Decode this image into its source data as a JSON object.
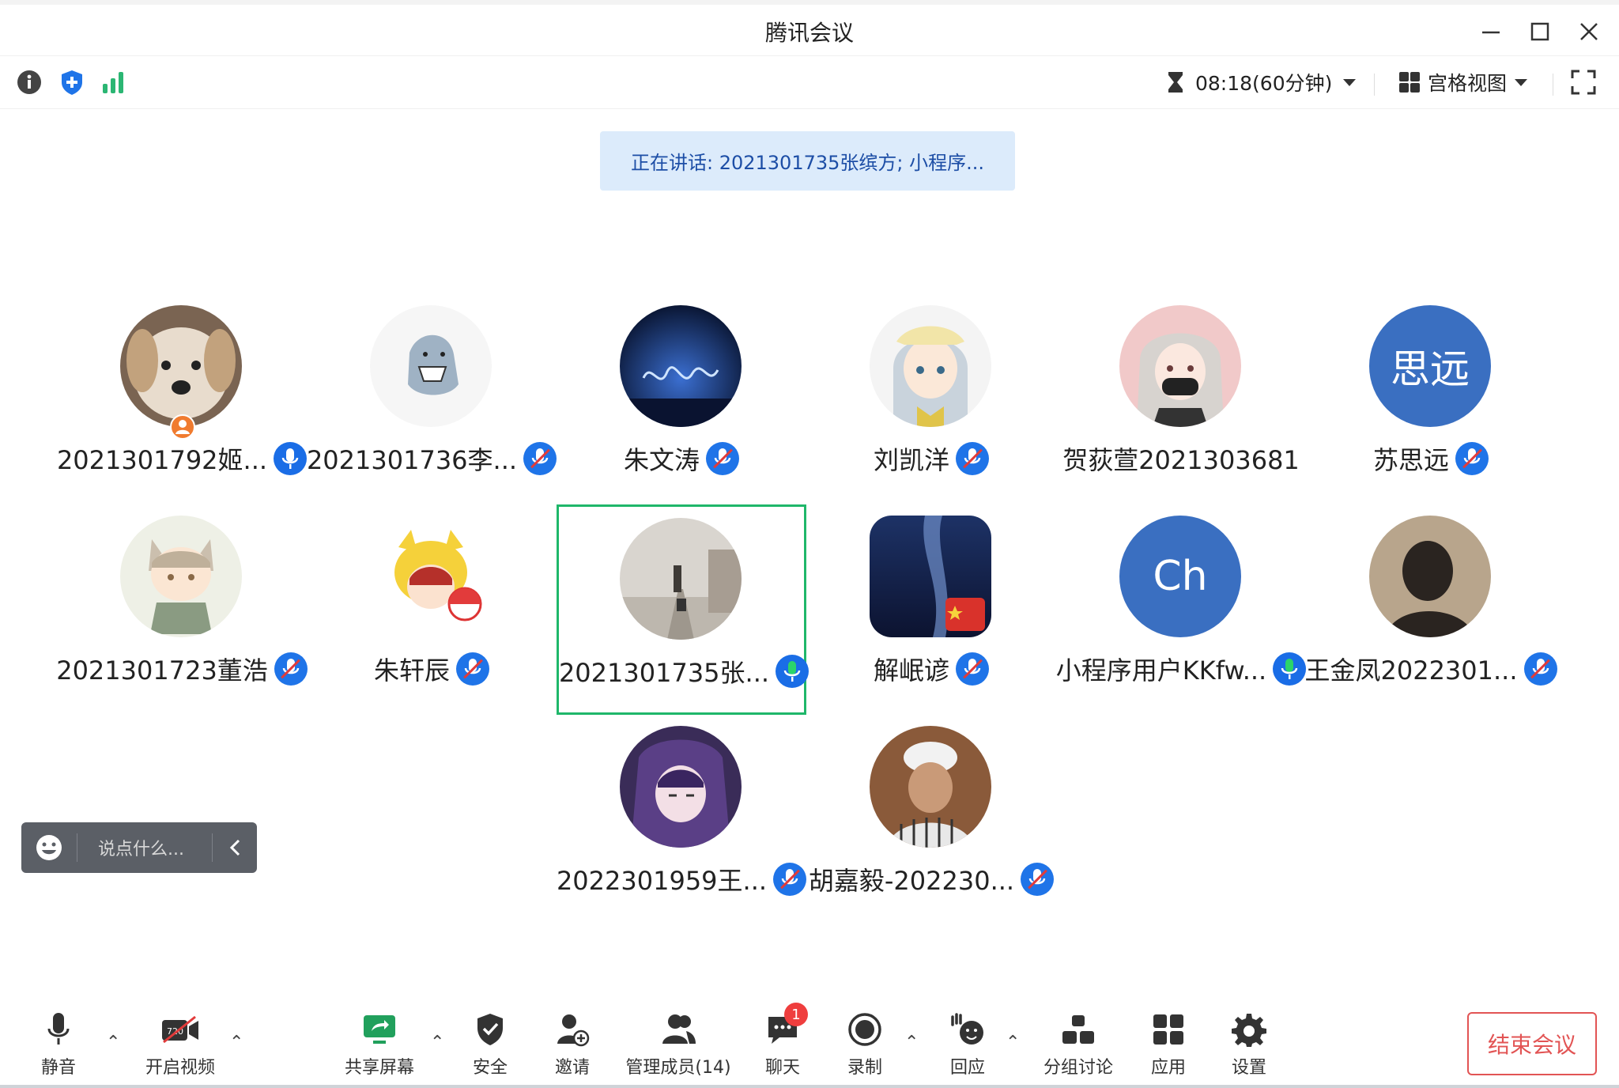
{
  "window": {
    "title": "腾讯会议"
  },
  "topbar": {
    "timer": "08:18(60分钟)",
    "view_mode": "宫格视图"
  },
  "speaking_banner": "正在讲话: 2021301735张缤方; 小程序...",
  "participants": [
    {
      "name": "2021301792姬...",
      "avatar": "dog-photo",
      "mic": "on",
      "host": true
    },
    {
      "name": "2021301736李...",
      "avatar": "shark-cartoon",
      "mic": "muted"
    },
    {
      "name": "朱文涛",
      "avatar": "night-light-photo",
      "mic": "muted"
    },
    {
      "name": "刘凯洋",
      "avatar": "anime-girl-white",
      "mic": "muted"
    },
    {
      "name": "贺荻萱2021303681",
      "avatar": "anime-girl-mask",
      "mic": "none"
    },
    {
      "name": "苏思远",
      "avatar_text": "思远",
      "mic": "muted"
    },
    {
      "name": "2021301723董浩",
      "avatar": "chibi-cat-boy",
      "mic": "muted"
    },
    {
      "name": "朱轩辰",
      "avatar": "pikachu-costume",
      "mic": "muted"
    },
    {
      "name": "2021301735张...",
      "avatar": "foggy-railway-photo",
      "mic": "speaking"
    },
    {
      "name": "解岷谚",
      "avatar": "milky-way-photo",
      "mic": "muted"
    },
    {
      "name": "小程序用户KKfw...",
      "avatar_text": "Ch",
      "mic": "on"
    },
    {
      "name": "王金凤2022301...",
      "avatar": "silhouette-photo",
      "mic": "muted"
    },
    {
      "name": "2022301959王...",
      "avatar": "anime-purple-girl",
      "mic": "muted"
    },
    {
      "name": "胡嘉毅-202230...",
      "avatar": "man-photo",
      "mic": "muted"
    }
  ],
  "chat_input": {
    "placeholder": "说点什么..."
  },
  "bottom_toolbar": {
    "mute": "静音",
    "video": "开启视频",
    "share": "共享屏幕",
    "security": "安全",
    "invite": "邀请",
    "members": "管理成员(14)",
    "chat": "聊天",
    "chat_badge": "1",
    "record": "录制",
    "react": "回应",
    "breakout": "分组讨论",
    "apps": "应用",
    "settings": "设置",
    "end": "结束会议"
  },
  "colors": {
    "accent": "#1f74e8",
    "speaking_border": "#1fb76a",
    "danger": "#e25454",
    "banner_bg": "#dcebfb"
  }
}
